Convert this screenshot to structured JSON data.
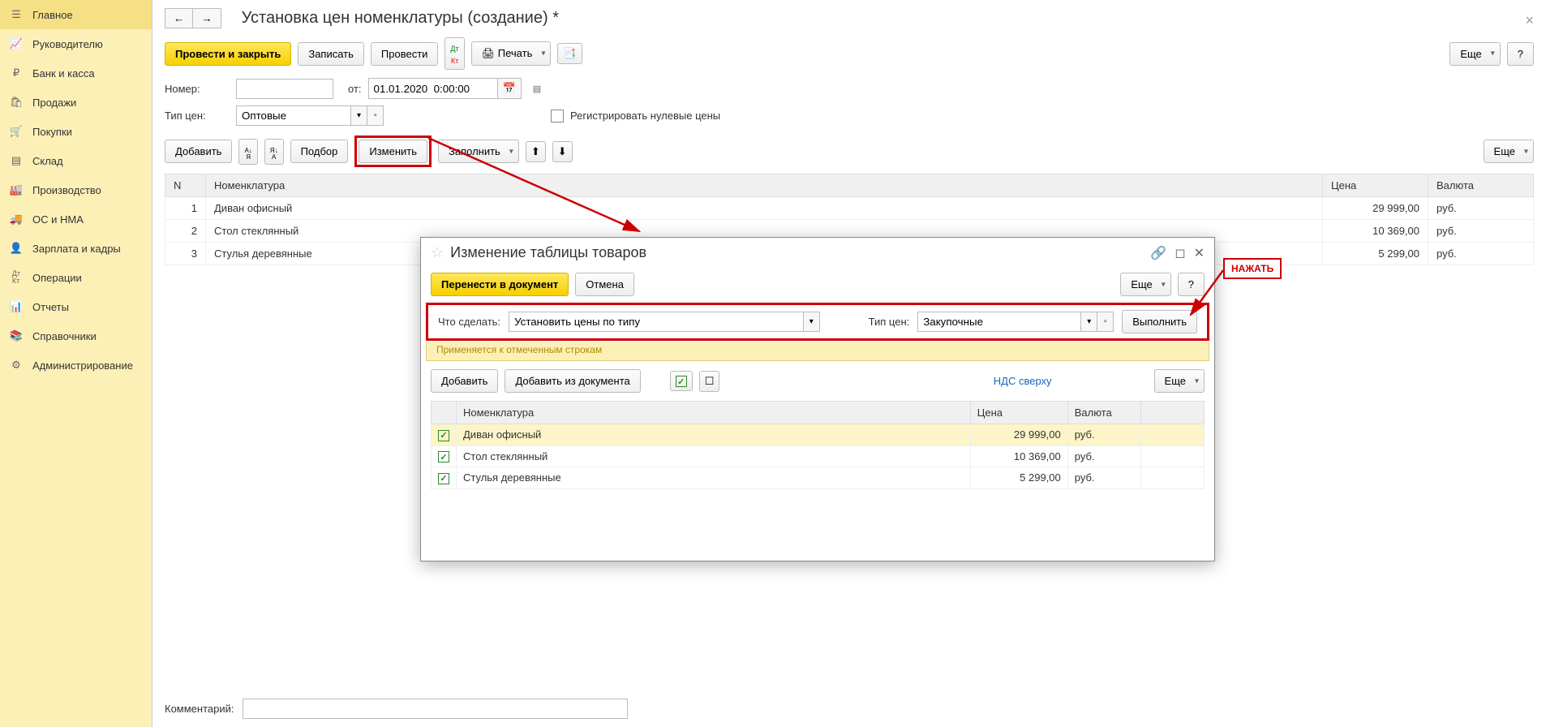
{
  "sidebar": {
    "items": [
      {
        "label": "Главное"
      },
      {
        "label": "Руководителю"
      },
      {
        "label": "Банк и касса"
      },
      {
        "label": "Продажи"
      },
      {
        "label": "Покупки"
      },
      {
        "label": "Склад"
      },
      {
        "label": "Производство"
      },
      {
        "label": "ОС и НМА"
      },
      {
        "label": "Зарплата и кадры"
      },
      {
        "label": "Операции"
      },
      {
        "label": "Отчеты"
      },
      {
        "label": "Справочники"
      },
      {
        "label": "Администрирование"
      }
    ]
  },
  "header": {
    "title": "Установка цен номенклатуры (создание) *"
  },
  "toolbar": {
    "post_close": "Провести и закрыть",
    "save": "Записать",
    "post": "Провести",
    "print": "Печать",
    "more": "Еще",
    "help": "?"
  },
  "form": {
    "number_label": "Номер:",
    "number_value": "",
    "from_label": "от:",
    "date_value": "01.01.2020  0:00:00",
    "price_type_label": "Тип цен:",
    "price_type_value": "Оптовые",
    "reg_zero_label": "Регистрировать нулевые цены"
  },
  "actions": {
    "add": "Добавить",
    "pick": "Подбор",
    "change": "Изменить",
    "fill": "Заполнить",
    "more": "Еще"
  },
  "table": {
    "cols": {
      "n": "N",
      "nom": "Номенклатура",
      "price": "Цена",
      "cur": "Валюта"
    },
    "rows": [
      {
        "n": "1",
        "nom": "Диван офисный",
        "price": "29 999,00",
        "cur": "руб."
      },
      {
        "n": "2",
        "nom": "Стол стеклянный",
        "price": "10 369,00",
        "cur": "руб."
      },
      {
        "n": "3",
        "nom": "Стулья деревянные",
        "price": "5 299,00",
        "cur": "руб."
      }
    ]
  },
  "dialog": {
    "title": "Изменение таблицы товаров",
    "transfer": "Перенести в документ",
    "cancel": "Отмена",
    "more": "Еще",
    "help": "?",
    "what_label": "Что сделать:",
    "what_value": "Установить цены по типу",
    "type_label": "Тип цен:",
    "type_value": "Закупочные",
    "execute": "Выполнить",
    "hint": "Применяется к отмеченным строкам",
    "add": "Добавить",
    "add_from_doc": "Добавить из документа",
    "vat": "НДС сверху",
    "more2": "Еще",
    "cols": {
      "nom": "Номенклатура",
      "price": "Цена",
      "cur": "Валюта"
    },
    "rows": [
      {
        "nom": "Диван офисный",
        "price": "29 999,00",
        "cur": "руб."
      },
      {
        "nom": "Стол стеклянный",
        "price": "10 369,00",
        "cur": "руб."
      },
      {
        "nom": "Стулья деревянные",
        "price": "5 299,00",
        "cur": "руб."
      }
    ]
  },
  "annot": {
    "press": "НАЖАТЬ"
  },
  "comment": {
    "label": "Комментарий:",
    "value": ""
  }
}
